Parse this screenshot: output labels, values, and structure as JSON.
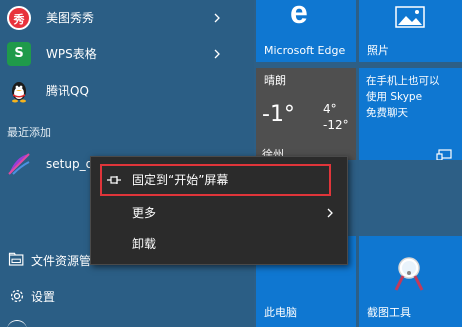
{
  "app_list": {
    "items": [
      {
        "label": "美图秀秀",
        "icon": "meitu-xiuxiu-icon",
        "icon_glyph": "秀",
        "icon_color": "#e8323c",
        "has_submenu": true
      },
      {
        "label": "WPS表格",
        "icon": "wps-spreadsheet-icon",
        "icon_glyph": "S",
        "icon_color": "#1f9a4a",
        "has_submenu": true
      },
      {
        "label": "腾讯QQ",
        "icon": "qq-penguin-icon",
        "has_submenu": false
      }
    ],
    "recent_section_label": "最近添加",
    "recent_item": {
      "label": "setup_d",
      "icon": "setup-installer-icon"
    }
  },
  "bottom_items": [
    {
      "label": "文件资源管",
      "icon": "file-explorer-icon"
    },
    {
      "label": "设置",
      "icon": "gear-icon"
    }
  ],
  "tiles": {
    "edge": {
      "label": "Microsoft Edge",
      "icon": "edge-icon",
      "icon_glyph": "e",
      "color": "#0f77d1"
    },
    "photos": {
      "label": "照片",
      "icon": "photos-icon",
      "color": "#0f77d1"
    },
    "weather": {
      "condition": "晴朗",
      "current_temp": "-1°",
      "high_temp": "4°",
      "low_temp": "-12°",
      "location_partial": "徐州",
      "color": "#5a5a5a"
    },
    "skype": {
      "line1": "在手机上也可以",
      "line2": "使用 Skype",
      "line3": "免费聊天",
      "icon": "skype-message-icon",
      "color": "#0f77d1"
    },
    "this_pc": {
      "label": "此电脑",
      "icon": "this-pc-icon",
      "color": "#0f77d1"
    },
    "snipping_tool": {
      "label": "截图工具",
      "icon": "snipping-tool-icon",
      "color": "#0f77d1"
    }
  },
  "context_menu": {
    "items": [
      {
        "label": "固定到“开始”屏幕",
        "icon": "pin-icon",
        "highlighted": true
      },
      {
        "label": "更多",
        "has_submenu": true
      },
      {
        "label": "卸载"
      }
    ],
    "highlight_color": "#e0353a"
  }
}
